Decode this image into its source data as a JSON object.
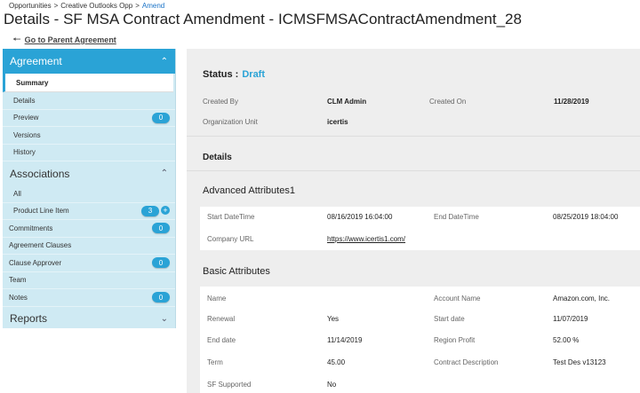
{
  "breadcrumb": {
    "items": [
      "Opportunities",
      "Creative Outlooks Opp",
      "Amend"
    ],
    "separator": ">"
  },
  "page_title": "Details - SF MSA Contract Amendment - ICMSFMSAContractAmendment_28",
  "back_link": "Go to Parent Agreement",
  "sidebar": {
    "agreement": {
      "label": "Agreement",
      "items": [
        {
          "label": "Summary"
        },
        {
          "label": "Details"
        },
        {
          "label": "Preview",
          "badge": "0"
        },
        {
          "label": "Versions"
        },
        {
          "label": "History"
        }
      ]
    },
    "associations": {
      "label": "Associations",
      "items": [
        {
          "label": "All"
        },
        {
          "label": "Product Line Item",
          "badge": "3"
        }
      ]
    },
    "top_items": [
      {
        "label": "Commitments",
        "badge": "0"
      },
      {
        "label": "Agreement Clauses"
      },
      {
        "label": "Clause Approver",
        "badge": "0"
      },
      {
        "label": "Team"
      },
      {
        "label": "Notes",
        "badge": "0"
      }
    ],
    "reports": {
      "label": "Reports"
    }
  },
  "main": {
    "status_label": "Status :",
    "status_value": "Draft",
    "created_by_label": "Created By",
    "created_by_value": "CLM Admin",
    "created_on_label": "Created On",
    "created_on_value": "11/28/2019",
    "org_unit_label": "Organization Unit",
    "org_unit_value": "icertis",
    "details_heading": "Details",
    "advanced": {
      "heading": "Advanced Attributes1",
      "start_label": "Start DateTime",
      "start_value": "08/16/2019 16:04:00",
      "end_label": "End DateTime",
      "end_value": "08/25/2019 18:04:00",
      "url_label": "Company URL",
      "url_value": "https://www.icertis1.com/"
    },
    "basic": {
      "heading": "Basic Attributes",
      "name_label": "Name",
      "name_value": "",
      "account_label": "Account Name",
      "account_value": "Amazon.com, Inc.",
      "renewal_label": "Renewal",
      "renewal_value": "Yes",
      "startdate_label": "Start date",
      "startdate_value": "11/07/2019",
      "enddate_label": "End date",
      "enddate_value": "11/14/2019",
      "region_label": "Region Profit",
      "region_value": "52.00 %",
      "term_label": "Term",
      "term_value": "45.00",
      "desc_label": "Contract Description",
      "desc_value": "Test Des v13123",
      "sf_label": "SF Supported",
      "sf_value": "No"
    }
  },
  "colors": {
    "accent": "#2aa3d6",
    "sidebar_bg": "#cfeaf3",
    "link": "#1a73c7"
  }
}
